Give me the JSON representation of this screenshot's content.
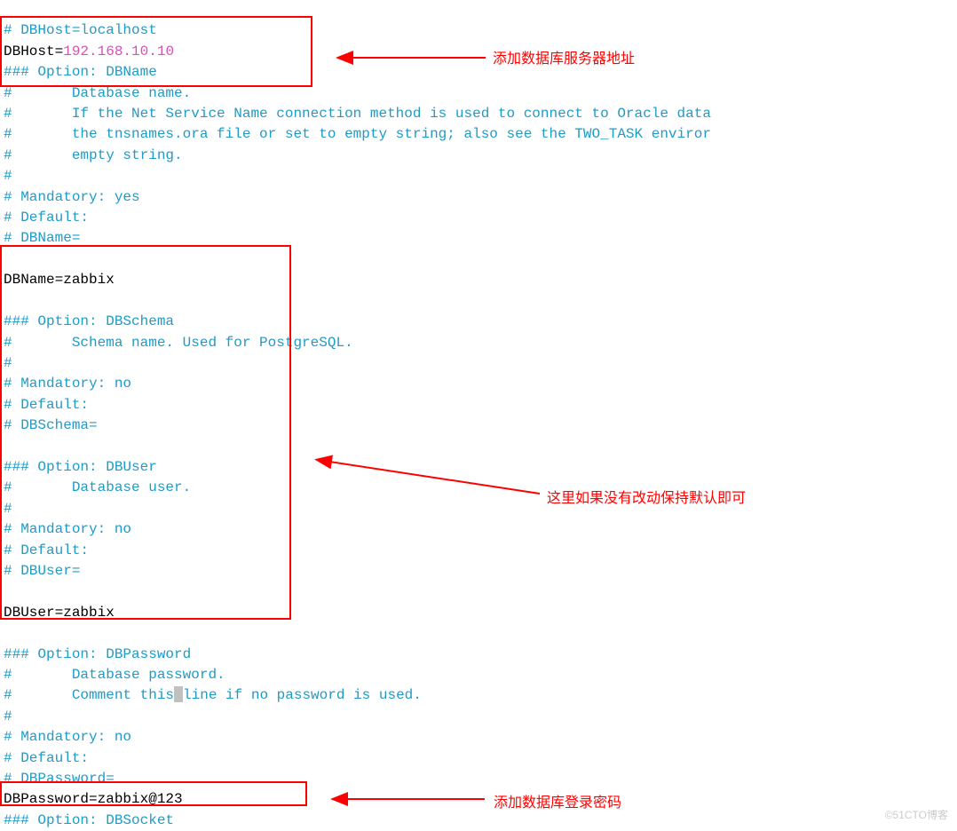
{
  "lines": {
    "l0": "# DBHost=localhost",
    "l1_key": "DBHost=",
    "l1_val": "192.168.10.10",
    "l2": "### Option: DBName",
    "l3": "#       Database name.",
    "l4": "#       If the Net Service Name connection method is used to connect to Oracle data",
    "l5": "#       the tnsnames.ora file or set to empty string; also see the TWO_TASK enviror",
    "l6": "#       empty string.",
    "l7": "#",
    "l8": "# Mandatory: yes",
    "l9": "# Default:",
    "l10": "# DBName=",
    "l11": "",
    "l12": "DBName=zabbix",
    "l13": "",
    "l14": "### Option: DBSchema",
    "l15": "#       Schema name. Used for PostgreSQL.",
    "l16": "#",
    "l17": "# Mandatory: no",
    "l18": "# Default:",
    "l19": "# DBSchema=",
    "l20": "",
    "l21": "### Option: DBUser",
    "l22": "#       Database user.",
    "l23": "#",
    "l24": "# Mandatory: no",
    "l25": "# Default:",
    "l26": "# DBUser=",
    "l27": "",
    "l28": "DBUser=zabbix",
    "l29": "",
    "l30": "### Option: DBPassword",
    "l31": "#       Database password.",
    "l32a": "#       Comment this",
    "l32b": "line if no password is used.",
    "l33": "#",
    "l34": "# Mandatory: no",
    "l35": "# Default:",
    "l36": "# DBPassword=",
    "l37": "DBPassword=zabbix@123",
    "l38": "### Option: DBSocket"
  },
  "annotations": {
    "a1": "添加数据库服务器地址",
    "a2": "这里如果没有改动保持默认即可",
    "a3": "添加数据库登录密码"
  },
  "watermark": "©51CTO博客"
}
